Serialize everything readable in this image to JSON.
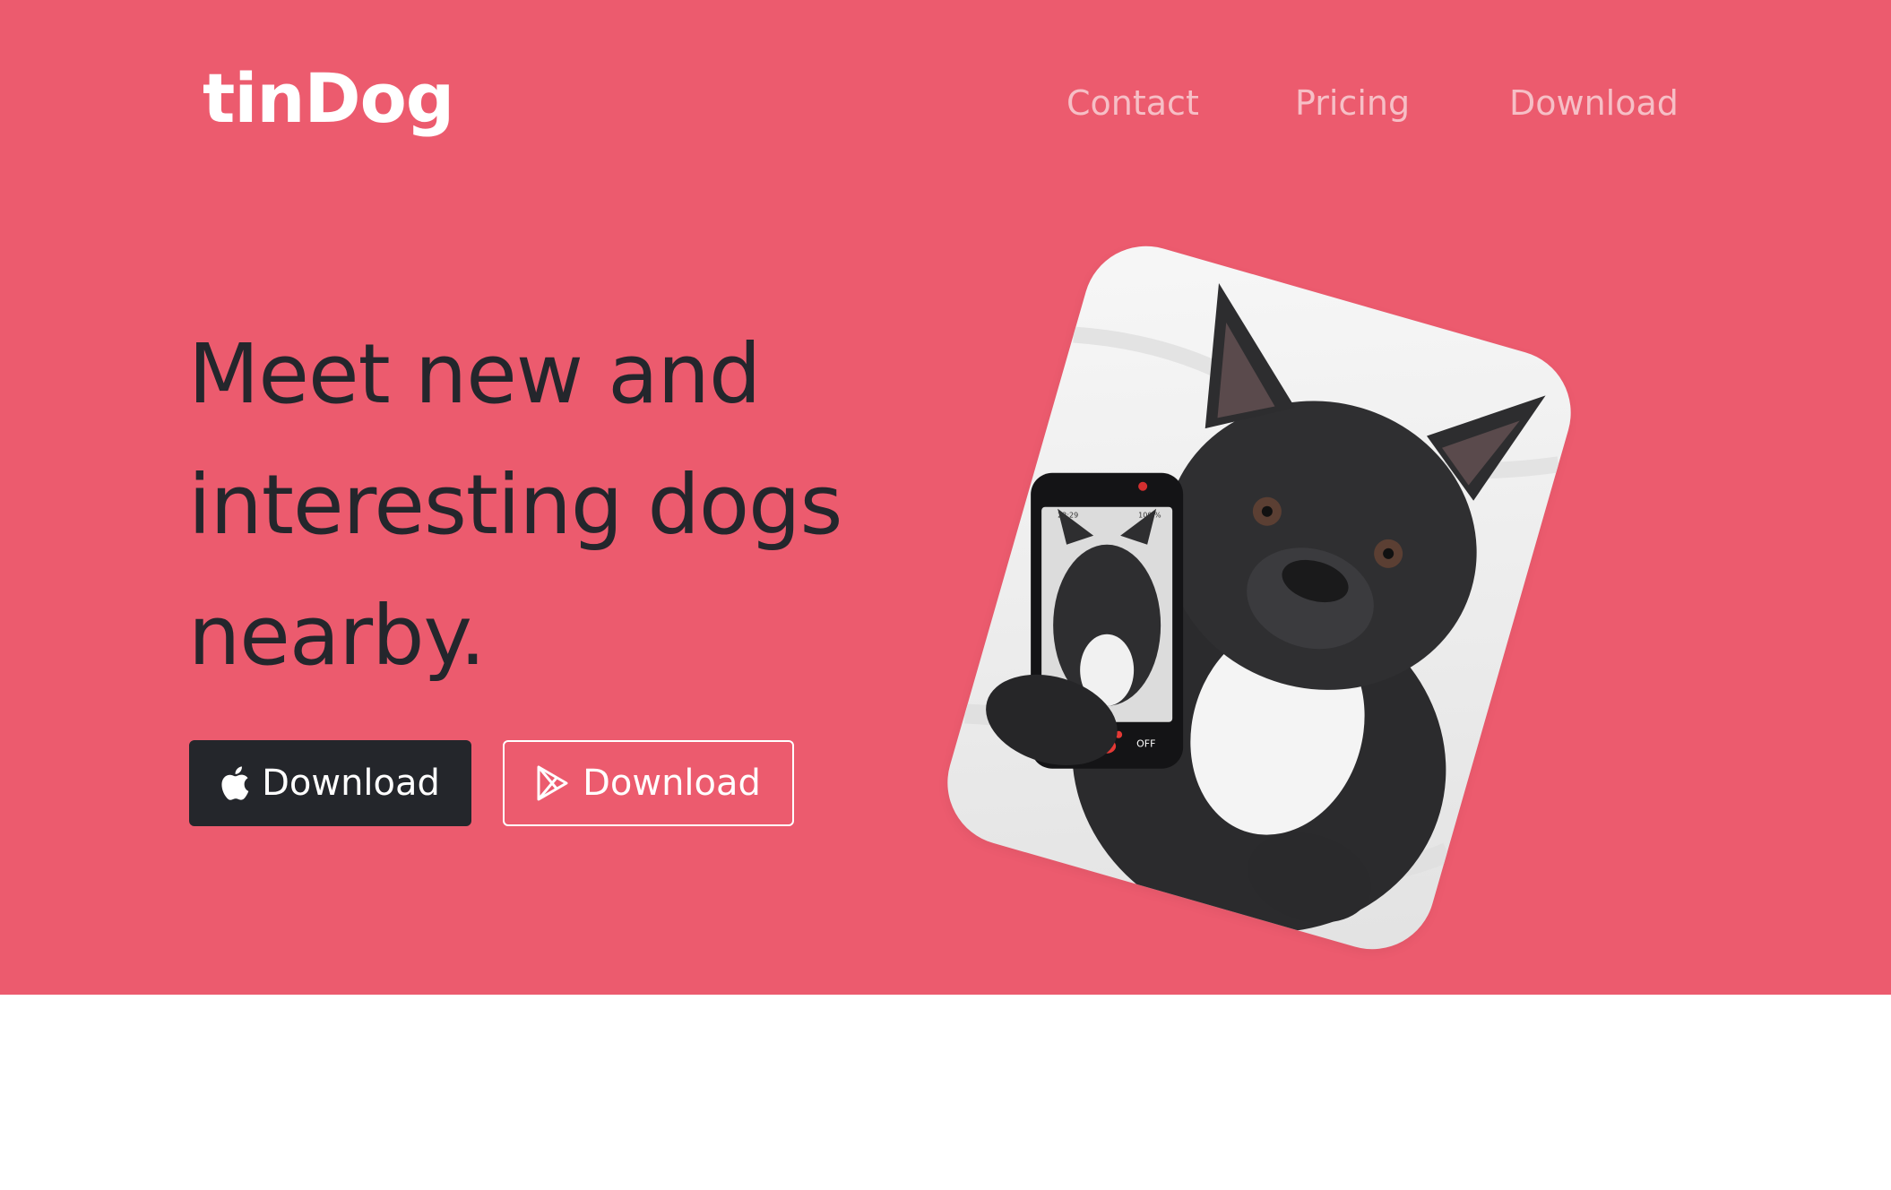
{
  "brand": "tinDog",
  "nav": {
    "contact": "Contact",
    "pricing": "Pricing",
    "download": "Download"
  },
  "hero": {
    "headline_line1": "Meet new and",
    "headline_line2": "interesting dogs",
    "headline_line3": "nearby.",
    "apple_button_label": "Download",
    "play_button_label": "Download",
    "phone_screen_left": "ON",
    "phone_screen_right": "OFF",
    "phone_status_time": "22:29",
    "phone_status_battery": "100 %"
  },
  "colors": {
    "hero_background": "#ec5b6e",
    "headline": "#24262c",
    "nav_link": "#f6bfc6",
    "dark_button": "#24262b"
  },
  "icons": {
    "apple": "apple-icon",
    "play": "google-play-icon",
    "paw": "paw-icon"
  }
}
